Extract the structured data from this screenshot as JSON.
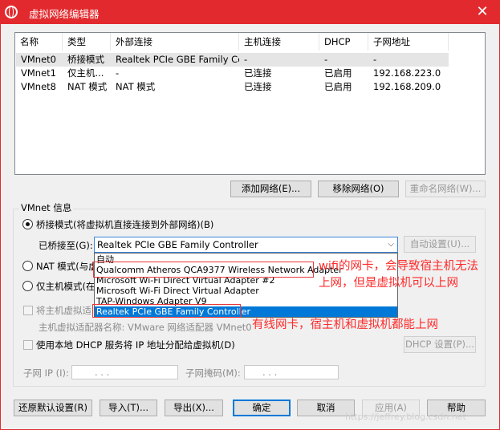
{
  "window": {
    "title": "虚拟网络编辑器",
    "close_glyph": "✕",
    "colors": {
      "titlebar": "#e22a2e",
      "selection": "#0078d7",
      "annotation": "#ff2a2a"
    }
  },
  "table": {
    "headers": [
      "名称",
      "类型",
      "外部连接",
      "主机连接",
      "DHCP",
      "子网地址"
    ],
    "rows": [
      [
        "VMnet0",
        "桥接模式",
        "Realtek PCIe GBE Family Co...",
        "-",
        "-",
        "-"
      ],
      [
        "VMnet1",
        "仅主机...",
        "-",
        "已连接",
        "已启用",
        "192.168.223.0"
      ],
      [
        "VMnet8",
        "NAT 模式",
        "NAT 模式",
        "已连接",
        "已启用",
        "192.168.209.0"
      ]
    ]
  },
  "list_buttons": {
    "add": "添加网络(E)...",
    "remove": "移除网络(O)",
    "rename": "重命名网络(W)..."
  },
  "vmnet_info": {
    "group_label": "VMnet 信息",
    "bridged_label": "桥接模式(将虚拟机直接连接到外部网络)(B)",
    "bridged_to_label": "已桥接至(G):",
    "bridged_to_value": "Realtek PCIe GBE Family Controller",
    "auto_settings": "自动设置(U)...",
    "nat_label": "NAT 模式(与虚",
    "hostonly_label": "仅主机模式(在",
    "connect_host_adapter": "将主机虚拟适",
    "host_adapter_name": "主机虚拟适配器名称: VMware 网络适配器 VMnet0",
    "dhcp_label": "使用本地 DHCP 服务将 IP 地址分配给虚拟机(D)",
    "dhcp_settings": "DHCP 设置(P)...",
    "subnet_ip_label": "子网 IP (I):",
    "subnet_mask_label": "子网掩码(M):",
    "ip_dots": ".        .        ."
  },
  "dropdown_options": [
    "自动",
    "Qualcomm Atheros QCA9377 Wireless Network Adapter",
    "Microsoft Wi-Fi Direct Virtual Adapter #2",
    "Microsoft Wi-Fi Direct Virtual Adapter",
    "TAP-Windows Adapter V9",
    "Realtek PCIe GBE Family Controller"
  ],
  "annotations": {
    "wifi_line1": "wifi的网卡，会导致宿主机无法",
    "wifi_line2": "上网，但是虚拟机可以上网",
    "wired": "有线网卡，宿主机和虚拟机都能上网"
  },
  "bottom_buttons": {
    "restore": "还原默认设置(R)",
    "import": "导入(T)...",
    "export": "导出(X)...",
    "ok": "确定",
    "cancel": "取消",
    "apply": "应用(A)",
    "help": "帮助"
  },
  "watermark": "https://jeffrey.blog.csdn.net"
}
